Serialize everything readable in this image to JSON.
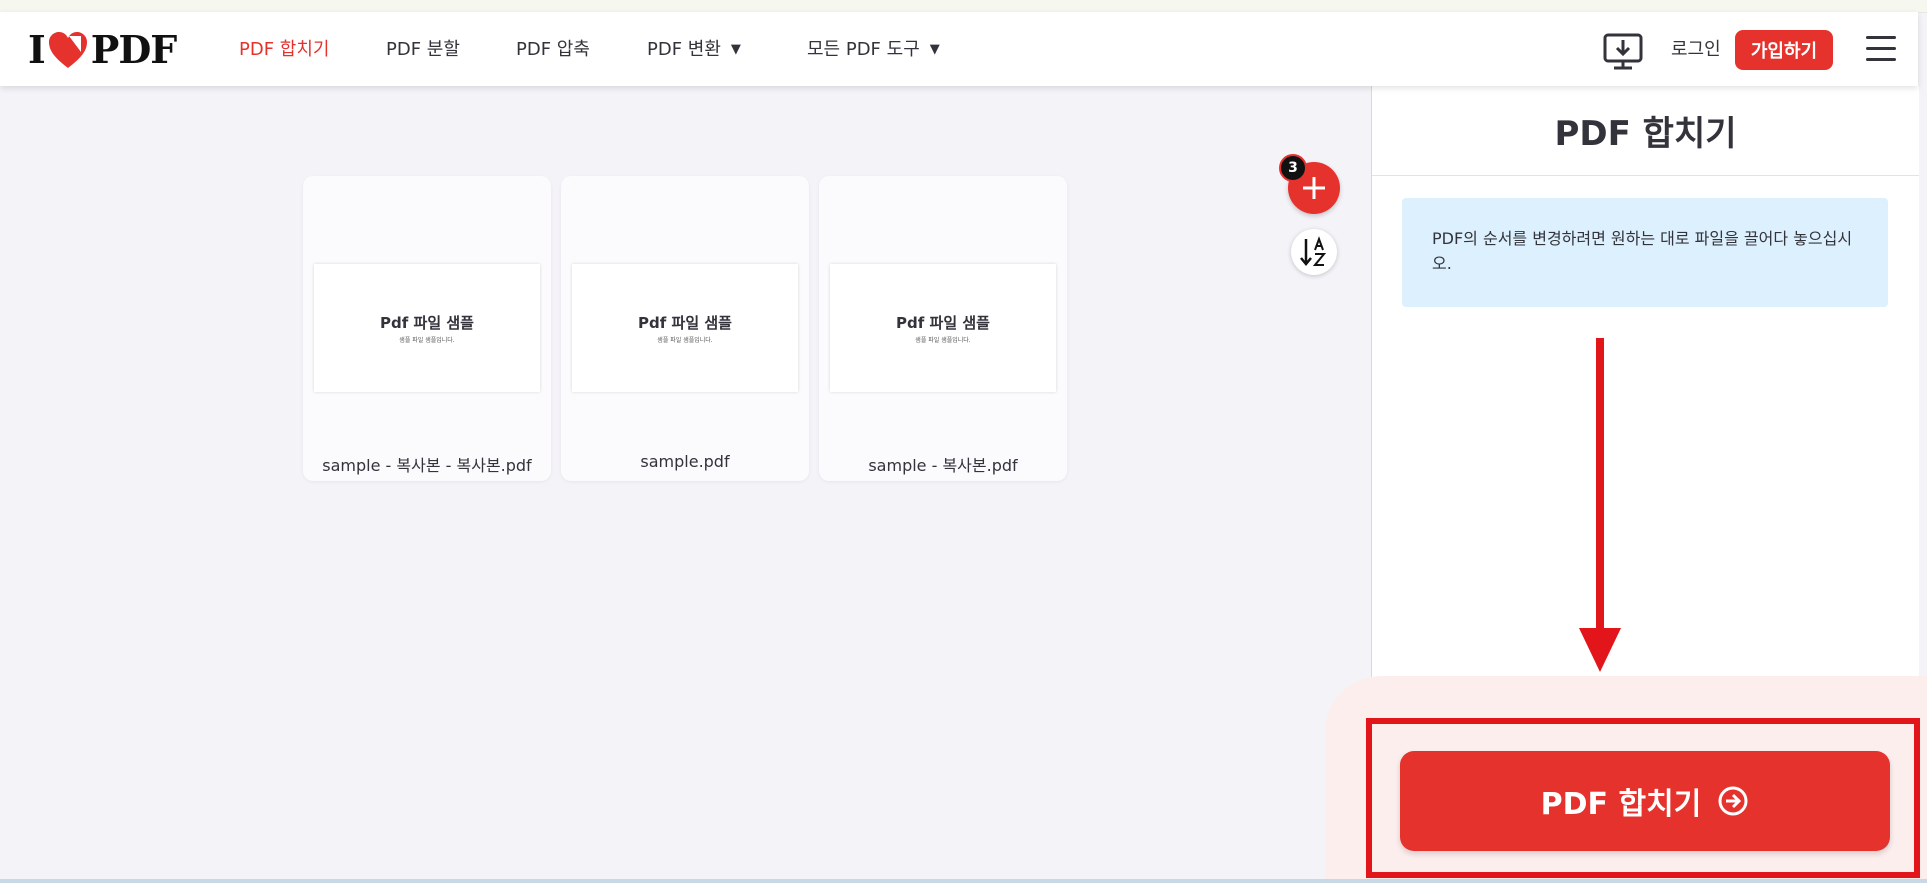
{
  "header": {
    "logo_left": "I",
    "logo_right": "PDF",
    "nav": [
      {
        "label": "PDF 합치기",
        "active": true
      },
      {
        "label": "PDF 분할"
      },
      {
        "label": "PDF 압축"
      },
      {
        "label": "PDF 변환"
      },
      {
        "label": "모든 PDF 도구"
      }
    ],
    "dropdown_caret": "▼",
    "login": "로그인",
    "signup": "가입하기"
  },
  "workspace": {
    "file_count": "3",
    "add_icon": "plus-icon",
    "sort_icon": "sort-az-icon",
    "files": [
      {
        "thumb_title": "Pdf 파일 샘플",
        "thumb_sub": "샘플 파일 샘플입니다.",
        "name": "sample - 복사본 - 복사본.pdf"
      },
      {
        "thumb_title": "Pdf 파일 샘플",
        "thumb_sub": "샘플 파일 샘플입니다.",
        "name": "sample.pdf"
      },
      {
        "thumb_title": "Pdf 파일 샘플",
        "thumb_sub": "샘플 파일 샘플입니다.",
        "name": "sample - 복사본.pdf"
      }
    ]
  },
  "sidebar": {
    "title": "PDF 합치기",
    "info": "PDF의 순서를 변경하려면 원하는 대로 파일을 끌어다 놓으십시오.",
    "merge_button": "PDF 합치기"
  },
  "colors": {
    "brand": "#e5322d",
    "annotation": "#e2151b",
    "info_bg": "#ddf0fd"
  }
}
